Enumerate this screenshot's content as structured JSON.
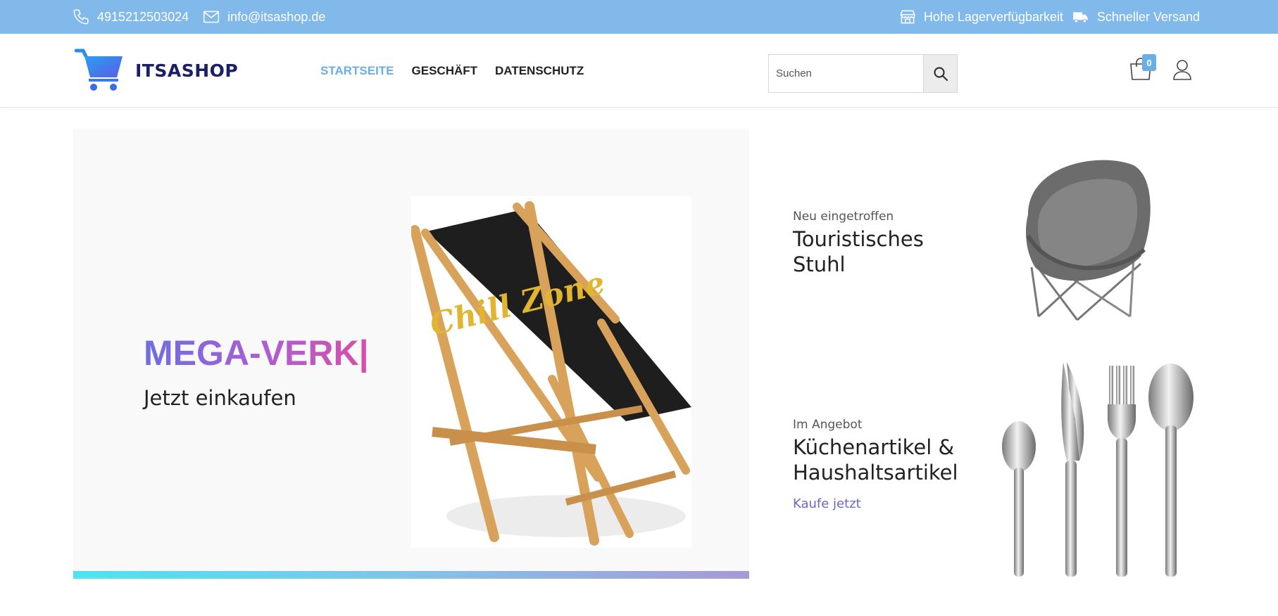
{
  "topbar": {
    "phone": "4915212503024",
    "email": "info@itsashop.de",
    "stock": "Hohe Lagerverfügbarkeit",
    "shipping": "Schneller Versand",
    "icons": [
      "phone-icon",
      "mail-icon",
      "warehouse-icon",
      "truck-icon"
    ]
  },
  "header": {
    "logo_text": "ITSASHOP",
    "nav": [
      {
        "label": "STARTSEITE",
        "active": true
      },
      {
        "label": "GESCHÄFT",
        "active": false
      },
      {
        "label": "DATENSCHUTZ",
        "active": false
      }
    ],
    "search_placeholder": "Suchen",
    "cart_count": "0",
    "icons": [
      "cart-icon",
      "search-icon",
      "shopping-bag-icon",
      "user-icon"
    ]
  },
  "hero": {
    "title": "MEGA-VERK|",
    "subtitle": "Jetzt einkaufen",
    "image_text": "Chill Zone"
  },
  "promos": [
    {
      "kicker": "Neu eingetroffen",
      "title": "Touristisches Stuhl",
      "link": ""
    },
    {
      "kicker": "Im Angebot",
      "title": "Küchenartikel & Haushaltsartikel",
      "link": "Kaufe jetzt"
    }
  ],
  "colors": {
    "topbar": "#81b9ea",
    "accent": "#6aaee6",
    "link": "#6b67c9",
    "logo": "#1a1f66"
  }
}
